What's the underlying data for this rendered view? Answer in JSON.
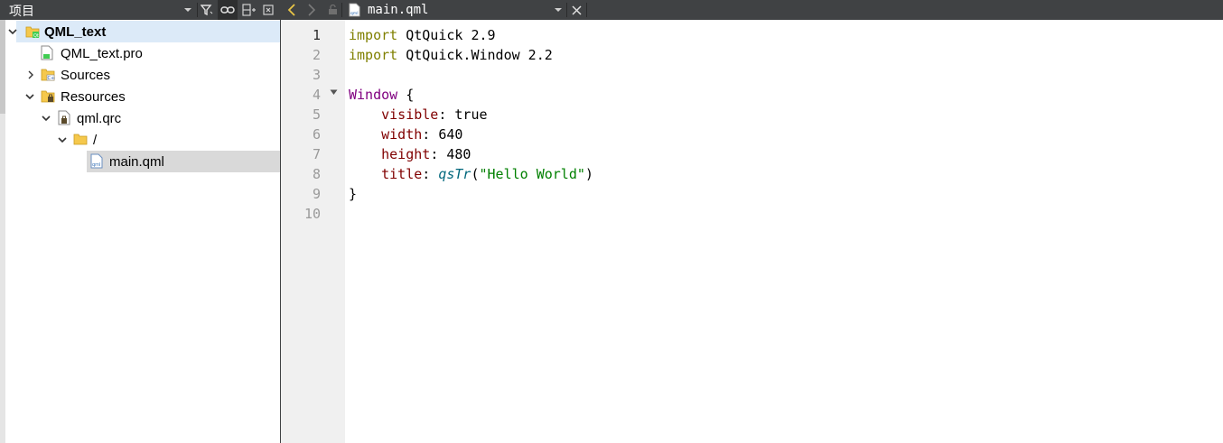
{
  "left_panel": {
    "title": "项目",
    "toolbar_icons": [
      "dropdown-arrow-icon",
      "filter-icon",
      "link-icon",
      "split-add-icon",
      "close-pane-icon"
    ],
    "tree": {
      "project": {
        "label": "QML_text",
        "expanded": true,
        "selected": true
      },
      "pro_file": {
        "label": "QML_text.pro"
      },
      "sources": {
        "label": "Sources",
        "expanded": false
      },
      "resources": {
        "label": "Resources",
        "expanded": true
      },
      "qrc": {
        "label": "qml.qrc",
        "expanded": true
      },
      "root_prefix": {
        "label": "/",
        "expanded": true
      },
      "main_file": {
        "label": "main.qml",
        "selected": true
      }
    }
  },
  "editor": {
    "toolbar": {
      "file_name": "main.qml"
    },
    "current_line": 1,
    "line_numbers": [
      "1",
      "2",
      "3",
      "4",
      "5",
      "6",
      "7",
      "8",
      "9",
      "10"
    ],
    "code": {
      "l1": {
        "kw": "import",
        "rest": " QtQuick 2.9"
      },
      "l2": {
        "kw": "import",
        "rest": " QtQuick.Window 2.2"
      },
      "l4": {
        "type": "Window",
        "rest": " {"
      },
      "l5": {
        "indent": "    ",
        "prop": "visible",
        "rest": ": true"
      },
      "l6": {
        "indent": "    ",
        "prop": "width",
        "rest": ": 640"
      },
      "l7": {
        "indent": "    ",
        "prop": "height",
        "rest": ": 480"
      },
      "l8": {
        "indent": "    ",
        "prop": "title",
        "sep": ": ",
        "fn": "qsTr",
        "open": "(",
        "str": "\"Hello World\"",
        "close": ")"
      },
      "l9": {
        "text": "}"
      }
    }
  },
  "colors": {
    "toolbar_bg": "#404244",
    "selection_blue": "#dceaf8",
    "selection_gray": "#d9d9d9",
    "keyword": "#808000",
    "type": "#800080",
    "property": "#800000",
    "function": "#00677c",
    "string": "#008000"
  }
}
